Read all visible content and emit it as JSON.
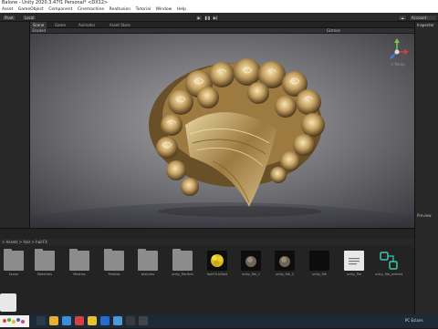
{
  "window": {
    "title": "Balone - Unity 2020.3.47f1 Personal* <DX12>"
  },
  "menu": [
    "Asset",
    "GameObject",
    "Component",
    "Cinemachine",
    "Realtusion",
    "Tutorial",
    "Window",
    "Help"
  ],
  "toolbar": {
    "pivot": "Pivot",
    "local": "Local",
    "account": "Account"
  },
  "tabs": {
    "scene": "Scene",
    "game": "Game",
    "animator": "Animator",
    "asset_store": "Asset Store",
    "inspector": "Inspector"
  },
  "scene_toolbar": {
    "shaded": "Shaded",
    "gizmos": "Gizmos",
    "persp": "< Persp"
  },
  "project": {
    "path": "> Assets > hair > hairFX",
    "assets": [
      {
        "label": "Scene"
      },
      {
        "label": "Materials"
      },
      {
        "label": "Meshes"
      },
      {
        "label": "Prefabs"
      },
      {
        "label": "textures"
      },
      {
        "label": "unity_file.fbm"
      },
      {
        "label": "hairFX.hiNoit"
      },
      {
        "label": "unity_file_1"
      },
      {
        "label": "unity_file_2"
      },
      {
        "label": "unity_file"
      },
      {
        "label": "unity_file"
      },
      {
        "label": "unity_file_animation"
      }
    ]
  },
  "preview_panel": {
    "label": "Preview"
  },
  "taskbar": {
    "label": "PC Eclairs"
  }
}
